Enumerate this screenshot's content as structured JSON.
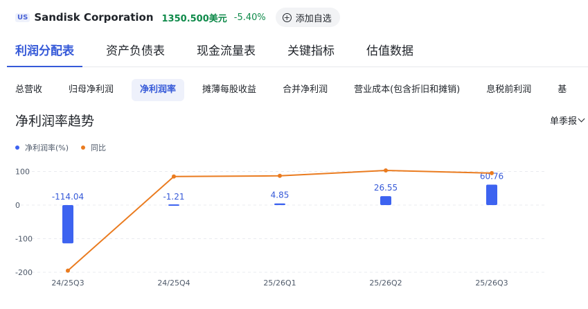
{
  "header": {
    "market": "US",
    "name": "Sandisk Corporation",
    "price": "1350.500美元",
    "change": "-5.40%",
    "add_label": "添加自选"
  },
  "tabs": [
    "利润分配表",
    "资产负债表",
    "现金流量表",
    "关键指标",
    "估值数据"
  ],
  "subtabs": [
    "总营收",
    "归母净利润",
    "净利润率",
    "摊薄每股收益",
    "合并净利润",
    "营业成本(包含折旧和摊销)",
    "息税前利润",
    "基"
  ],
  "section_title": "净利润率趋势",
  "period_label": "单季报",
  "colors": {
    "bar": "#3d63f0",
    "line": "#ea7b1f",
    "accent": "#3559d8",
    "up_down": "#0f8a4a"
  },
  "chart_data": {
    "type": "bar",
    "categories": [
      "24/25Q3",
      "24/25Q4",
      "25/26Q1",
      "25/26Q2",
      "25/26Q3"
    ],
    "series": [
      {
        "name": "净利润率(%)",
        "type": "bar",
        "values": [
          -114.04,
          -1.21,
          4.85,
          26.55,
          60.76
        ],
        "labels": [
          "-114.04",
          "-1.21",
          "4.85",
          "26.55",
          "60.76"
        ]
      },
      {
        "name": "同比",
        "type": "line",
        "values": [
          -195,
          85,
          87,
          103,
          95
        ]
      }
    ],
    "ytick_labels": [
      "100",
      "0",
      "-100",
      "-200"
    ],
    "yticks": [
      100,
      0,
      -100,
      -200
    ],
    "ylim": [
      -200,
      100
    ],
    "legend": "top-left",
    "grid": true
  }
}
